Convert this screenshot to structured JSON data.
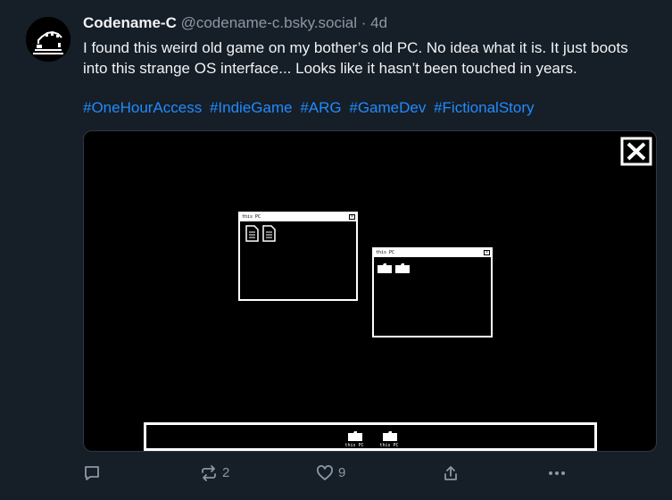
{
  "post": {
    "display_name": "Codename-C",
    "handle": "@codename-c.bsky.social",
    "separator": "·",
    "time_ago": "4d",
    "text": "I found this weird old game on my bother’s old PC. No idea what it is. It just boots into this strange OS interface... Looks like it hasn’t been touched in years.",
    "hashtags": [
      "#OneHourAccess",
      "#IndieGame",
      "#ARG",
      "#GameDev",
      "#FictionalStory"
    ]
  },
  "media": {
    "window1_title": "this PC",
    "window2_title": "this PC",
    "taskbar_items": [
      {
        "label": "this PC"
      },
      {
        "label": "this PC"
      }
    ]
  },
  "actions": {
    "reply_count": "",
    "repost_count": "2",
    "like_count": "9"
  },
  "icons": {
    "avatar": "pixel-avatar-icon",
    "reply": "reply-bubble-icon",
    "repost": "repost-icon",
    "like": "heart-icon",
    "share": "share-icon",
    "more": "more-dots-icon",
    "close": "close-x-icon",
    "document": "document-icon",
    "folder": "folder-icon"
  },
  "colors": {
    "background": "#161e27",
    "link": "#208bfe",
    "muted": "#8b98a5",
    "text": "#f1f3f5"
  }
}
